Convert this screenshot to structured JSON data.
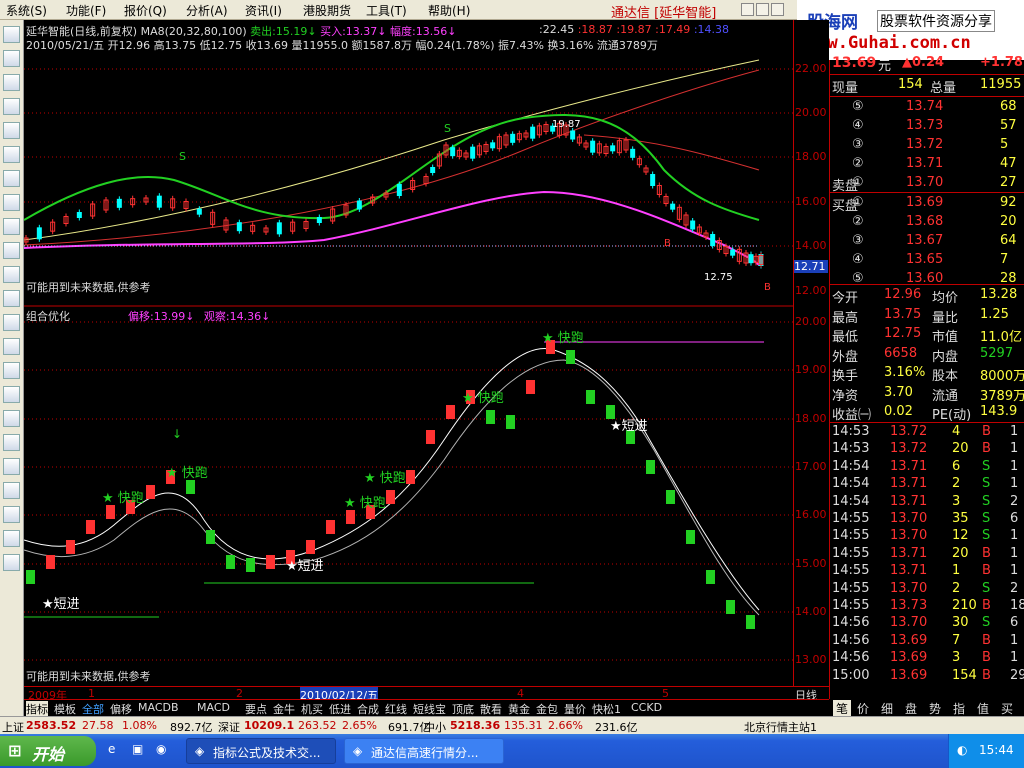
{
  "menu": [
    "系统(S)",
    "功能(F)",
    "报价(Q)",
    "分析(A)",
    "资讯(I)",
    "港股期货",
    "工具(T)",
    "帮助(H)"
  ],
  "app_title": "通达信 [延华智能]",
  "ad": {
    "site": "股海网",
    "sub": "股票软件资源分享",
    "url": "www.Guhai.com.cn"
  },
  "chart": {
    "header1": {
      "name": "延华智能(日线,前复权)",
      "ma": "MA8(20,32,80,100)",
      "sell": "卖出:15.19",
      "buy": "买入:13.37",
      "range": "幅度:13.56",
      "v1": ":22.45",
      "v2": ":18.87",
      "v3": ":19.87",
      "v4": ":17.49",
      "v5": ":14.38"
    },
    "header2": "2010/05/21/五 开12.96 高13.75 低12.75 收13.69 量11955.0 额1587.8万 幅0.24(1.78%) 振7.43% 换3.16% 流通3789万",
    "warning": "可能用到未来数据,供参考",
    "sub_title": "组合优化",
    "sub_params": {
      "bias": "偏移:13.99",
      "obs": "观察:14.36"
    },
    "upper_axis": [
      "22.00",
      "20.00",
      "18.00",
      "16.00",
      "14.00",
      "12.00"
    ],
    "upper_price_tag": "12.71",
    "lower_axis": [
      "20.00",
      "19.00",
      "18.00",
      "17.00",
      "16.00",
      "15.00",
      "14.00",
      "13.00"
    ],
    "label_peak": "19.87",
    "label_low": "12.75",
    "signals": {
      "run": "快跑",
      "short_in": "短进",
      "s": "S",
      "b": "B"
    },
    "time_axis": [
      "2009年",
      "1",
      "2",
      "2010/02/12/五",
      "4",
      "5"
    ],
    "period_label": "日线"
  },
  "chart_data": {
    "type": "candlestick",
    "title": "延华智能(日线,前复权)",
    "ylim": [
      12,
      22
    ],
    "last": {
      "open": 12.96,
      "high": 13.75,
      "low": 12.75,
      "close": 13.69
    }
  },
  "quote": {
    "price": "13.69",
    "unit": "元",
    "change": "▲0.24",
    "pct": "+1.78",
    "now_label": "现量",
    "now_vol": "154",
    "total_label": "总量",
    "total_vol": "11955",
    "asks": [
      [
        "⑤",
        "13.74",
        "68"
      ],
      [
        "④",
        "13.73",
        "57"
      ],
      [
        "③",
        "13.72",
        "5"
      ],
      [
        "②",
        "13.71",
        "47"
      ],
      [
        "①",
        "13.70",
        "27"
      ]
    ],
    "ask_label": "卖盘",
    "bids": [
      [
        "①",
        "13.69",
        "92"
      ],
      [
        "②",
        "13.68",
        "20"
      ],
      [
        "③",
        "13.67",
        "64"
      ],
      [
        "④",
        "13.65",
        "7"
      ],
      [
        "⑤",
        "13.60",
        "28"
      ]
    ],
    "bid_label": "买盘",
    "stats": [
      [
        "今开",
        "12.96",
        "均价",
        "13.28"
      ],
      [
        "最高",
        "13.75",
        "量比",
        "1.25"
      ],
      [
        "最低",
        "12.75",
        "市值",
        "11.0亿"
      ],
      [
        "外盘",
        "6658",
        "内盘",
        "5297"
      ],
      [
        "换手",
        "3.16%",
        "股本",
        "8000万"
      ],
      [
        "净资",
        "3.70",
        "流通",
        "3789万"
      ],
      [
        "收益㈠",
        "0.02",
        "PE(动)",
        "143.9"
      ]
    ],
    "ticks": [
      [
        "14:53",
        "13.72",
        "4",
        "B",
        "1"
      ],
      [
        "14:53",
        "13.72",
        "20",
        "B",
        "1"
      ],
      [
        "14:54",
        "13.71",
        "6",
        "S",
        "1"
      ],
      [
        "14:54",
        "13.71",
        "2",
        "S",
        "1"
      ],
      [
        "14:54",
        "13.71",
        "3",
        "S",
        "2"
      ],
      [
        "14:55",
        "13.70",
        "35",
        "S",
        "6"
      ],
      [
        "14:55",
        "13.70",
        "12",
        "S",
        "1"
      ],
      [
        "14:55",
        "13.71",
        "20",
        "B",
        "1"
      ],
      [
        "14:55",
        "13.71",
        "1",
        "B",
        "1"
      ],
      [
        "14:55",
        "13.70",
        "2",
        "S",
        "2"
      ],
      [
        "14:55",
        "13.73",
        "210",
        "B",
        "18"
      ],
      [
        "14:56",
        "13.70",
        "30",
        "S",
        "6"
      ],
      [
        "14:56",
        "13.69",
        "7",
        "B",
        "1"
      ],
      [
        "14:56",
        "13.69",
        "3",
        "B",
        "1"
      ],
      [
        "15:00",
        "13.69",
        "154",
        "B",
        "29"
      ]
    ],
    "tabs": [
      "笔",
      "价",
      "细",
      "盘",
      "势",
      "指",
      "值",
      "买"
    ]
  },
  "bottom_tabs": [
    "指标",
    "模板",
    "全部",
    "偏移",
    "MACDB",
    "MACD",
    "要点",
    "金牛",
    "机买",
    "低进",
    "合成",
    "红线",
    "短线宝",
    "顶底",
    "散看",
    "黄金",
    "金包",
    "量价",
    "快松1",
    "CCKD"
  ],
  "status": {
    "sh_label": "上证",
    "sh": "2583.52",
    "sh_chg": "27.58",
    "sh_pct": "1.08%",
    "sh_amt": "892.7亿",
    "sz_label": "深证",
    "sz": "10209.1",
    "sz_chg": "263.52",
    "sz_pct": "2.65%",
    "sz_amt": "691.7亿",
    "zx_label": "中小",
    "zx": "5218.36",
    "zx_chg": "135.31",
    "zx_pct": "2.66%",
    "zx_amt": "231.6亿",
    "server": "北京行情主站1"
  },
  "taskbar": {
    "start": "开始",
    "task1": "指标公式及技术交...",
    "task2": "通达信高速行情分...",
    "clock": "15:44"
  },
  "colors": {
    "up": "#ff3232",
    "down": "#00ffff",
    "ma_green": "#00e000",
    "ma_magenta": "#ff40ff",
    "accent": "#c00000"
  }
}
